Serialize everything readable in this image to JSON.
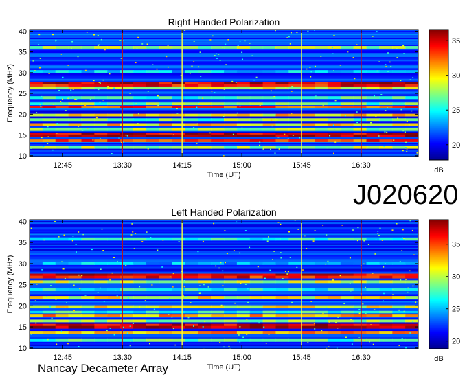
{
  "event_id": "J020620",
  "footer": "Nancay Decameter Array",
  "colors": {
    "colormap": [
      "#00008f",
      "#0000ff",
      "#0080ff",
      "#00ffff",
      "#80ff80",
      "#ffff00",
      "#ff8000",
      "#ff0000",
      "#800000"
    ],
    "marker_red": "#c01010",
    "marker_yellow": "#ffff40",
    "marker_cyan": "#60ffff"
  },
  "chart_data": [
    {
      "type": "heatmap",
      "title": "Right Handed Polarization",
      "xlabel": "Time (UT)",
      "ylabel": "Frequency (MHz)",
      "x_unit": "UT",
      "xlim": [
        "12:20",
        "17:13"
      ],
      "x_ticks": [
        "12:45",
        "13:30",
        "14:15",
        "15:00",
        "15:45",
        "16:30"
      ],
      "ylim": [
        9.8,
        40.4
      ],
      "y_ticks": [
        10,
        15,
        20,
        25,
        30,
        35,
        40
      ],
      "colorbar": {
        "label": "dB",
        "range": [
          17.8,
          36.6
        ],
        "ticks": [
          20,
          25,
          30,
          35
        ]
      },
      "vertical_markers": [
        {
          "time": "13:30",
          "color": "red"
        },
        {
          "time": "14:15",
          "color": "yellow"
        },
        {
          "time": "15:45",
          "color": "yellow"
        },
        {
          "time": "16:30",
          "color": "red"
        }
      ],
      "emission_bands_mhz": [
        {
          "freq": 27.5,
          "level_db": 35
        },
        {
          "freq": 27.0,
          "level_db": 34
        },
        {
          "freq": 26.3,
          "level_db": 29
        },
        {
          "freq": 24.0,
          "level_db": 26
        },
        {
          "freq": 22.5,
          "level_db": 27
        },
        {
          "freq": 21.7,
          "level_db": 33
        },
        {
          "freq": 19.8,
          "level_db": 30
        },
        {
          "freq": 18.7,
          "level_db": 27
        },
        {
          "freq": 17.5,
          "level_db": 30
        },
        {
          "freq": 16.3,
          "level_db": 28
        },
        {
          "freq": 15.2,
          "level_db": 35
        },
        {
          "freq": 14.8,
          "level_db": 36
        },
        {
          "freq": 13.6,
          "level_db": 33
        },
        {
          "freq": 12.0,
          "level_db": 28
        },
        {
          "freq": 36.1,
          "level_db": 28
        },
        {
          "freq": 30.3,
          "level_db": 24
        }
      ]
    },
    {
      "type": "heatmap",
      "title": "Left Handed Polarization",
      "xlabel": "Time (UT)",
      "ylabel": "Frequency (MHz)",
      "x_unit": "UT",
      "xlim": [
        "12:20",
        "17:13"
      ],
      "x_ticks": [
        "12:45",
        "13:30",
        "14:15",
        "15:00",
        "15:45",
        "16:30"
      ],
      "ylim": [
        9.8,
        40.4
      ],
      "y_ticks": [
        10,
        15,
        20,
        25,
        30,
        35,
        40
      ],
      "colorbar": {
        "label": "dB",
        "range": [
          18.8,
          38.8
        ],
        "ticks": [
          20,
          25,
          30,
          35
        ]
      },
      "vertical_markers": [
        {
          "time": "13:30",
          "color": "red"
        },
        {
          "time": "14:15",
          "color": "yellow"
        },
        {
          "time": "15:45",
          "color": "yellow"
        },
        {
          "time": "16:30",
          "color": "red"
        }
      ],
      "emission_bands_mhz": [
        {
          "freq": 27.3,
          "level_db": 37
        },
        {
          "freq": 26.8,
          "level_db": 36
        },
        {
          "freq": 25.7,
          "level_db": 30
        },
        {
          "freq": 23.8,
          "level_db": 27
        },
        {
          "freq": 22.0,
          "level_db": 31
        },
        {
          "freq": 19.8,
          "level_db": 31
        },
        {
          "freq": 18.5,
          "level_db": 27
        },
        {
          "freq": 17.6,
          "level_db": 33
        },
        {
          "freq": 16.4,
          "level_db": 29
        },
        {
          "freq": 15.4,
          "level_db": 37
        },
        {
          "freq": 14.9,
          "level_db": 38
        },
        {
          "freq": 13.7,
          "level_db": 33
        },
        {
          "freq": 11.8,
          "level_db": 28
        },
        {
          "freq": 35.8,
          "level_db": 27
        },
        {
          "freq": 30.0,
          "level_db": 25
        }
      ]
    }
  ]
}
